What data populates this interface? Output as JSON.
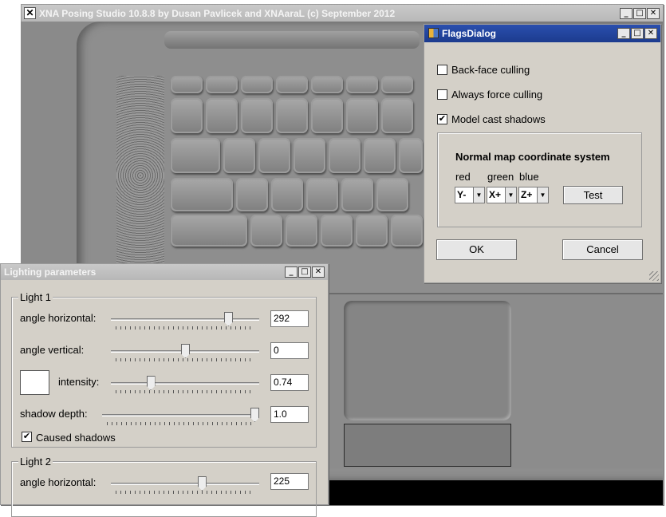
{
  "main_window": {
    "title": "XNA Posing Studio 10.8.8 by Dusan Pavlicek and XNAaraL (c) September 2012"
  },
  "flags_dialog": {
    "title": "FlagsDialog",
    "checkboxes": [
      {
        "label": "Back-face culling",
        "checked": false
      },
      {
        "label": "Always force culling",
        "checked": false
      },
      {
        "label": "Model cast shadows",
        "checked": true
      }
    ],
    "normal_map": {
      "title": "Normal map coordinate system",
      "labels": {
        "red": "red",
        "green": "green",
        "blue": "blue"
      },
      "values": {
        "red": "Y-",
        "green": "X+",
        "blue": "Z+"
      },
      "test_label": "Test"
    },
    "ok_label": "OK",
    "cancel_label": "Cancel"
  },
  "lighting": {
    "title": "Lighting parameters",
    "light1": {
      "group_label": "Light 1",
      "angle_horizontal_label": "angle horizontal:",
      "angle_horizontal": "292",
      "angle_horizontal_level": 0.81,
      "angle_vertical_label": "angle vertical:",
      "angle_vertical": "0",
      "angle_vertical_level": 0.5,
      "intensity_label": "intensity:",
      "intensity": "0.74",
      "intensity_level": 0.25,
      "shadow_depth_label": "shadow depth:",
      "shadow_depth": "1.0",
      "shadow_depth_level": 1.0,
      "caused_shadows_label": "Caused shadows",
      "caused_shadows": true,
      "color": "#ffffff"
    },
    "light2": {
      "group_label": "Light 2",
      "angle_horizontal_label": "angle horizontal:",
      "angle_horizontal": "225",
      "angle_horizontal_level": 0.62
    }
  },
  "icons": {
    "app": "xna-app-icon",
    "dialog": "form-icon",
    "min": "minimize-icon",
    "max": "maximize-icon",
    "close": "close-icon"
  },
  "colors": {
    "active_title": "#1c3b8e",
    "inactive_title": "#b7b7b7",
    "dialog_bg": "#d4d0c8"
  }
}
